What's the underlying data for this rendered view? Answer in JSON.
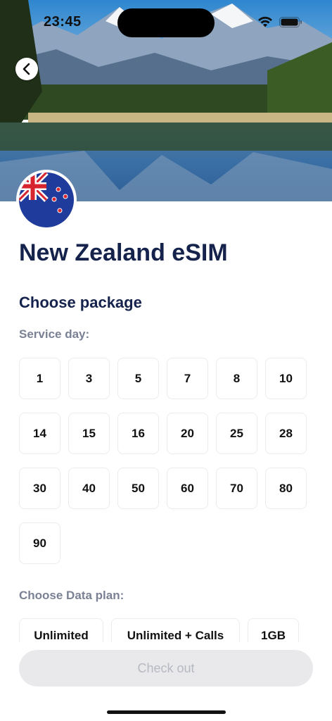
{
  "status_bar": {
    "time": "23:45"
  },
  "header": {
    "title": "New Zealand eSIM"
  },
  "package": {
    "heading": "Choose package",
    "service_day_label": "Service day:",
    "days": [
      "1",
      "3",
      "5",
      "7",
      "8",
      "10",
      "14",
      "15",
      "16",
      "20",
      "25",
      "28",
      "30",
      "40",
      "50",
      "60",
      "70",
      "80",
      "90"
    ],
    "data_plan_label": "Choose Data plan:",
    "plans": [
      "Unlimited",
      "Unlimited + Calls",
      "1GB"
    ]
  },
  "footer": {
    "checkout_label": "Check out"
  },
  "colors": {
    "title": "#15224b",
    "muted": "#7a8194",
    "button_disabled_bg": "#e9e9ec",
    "button_disabled_text": "#b6b9c2"
  }
}
